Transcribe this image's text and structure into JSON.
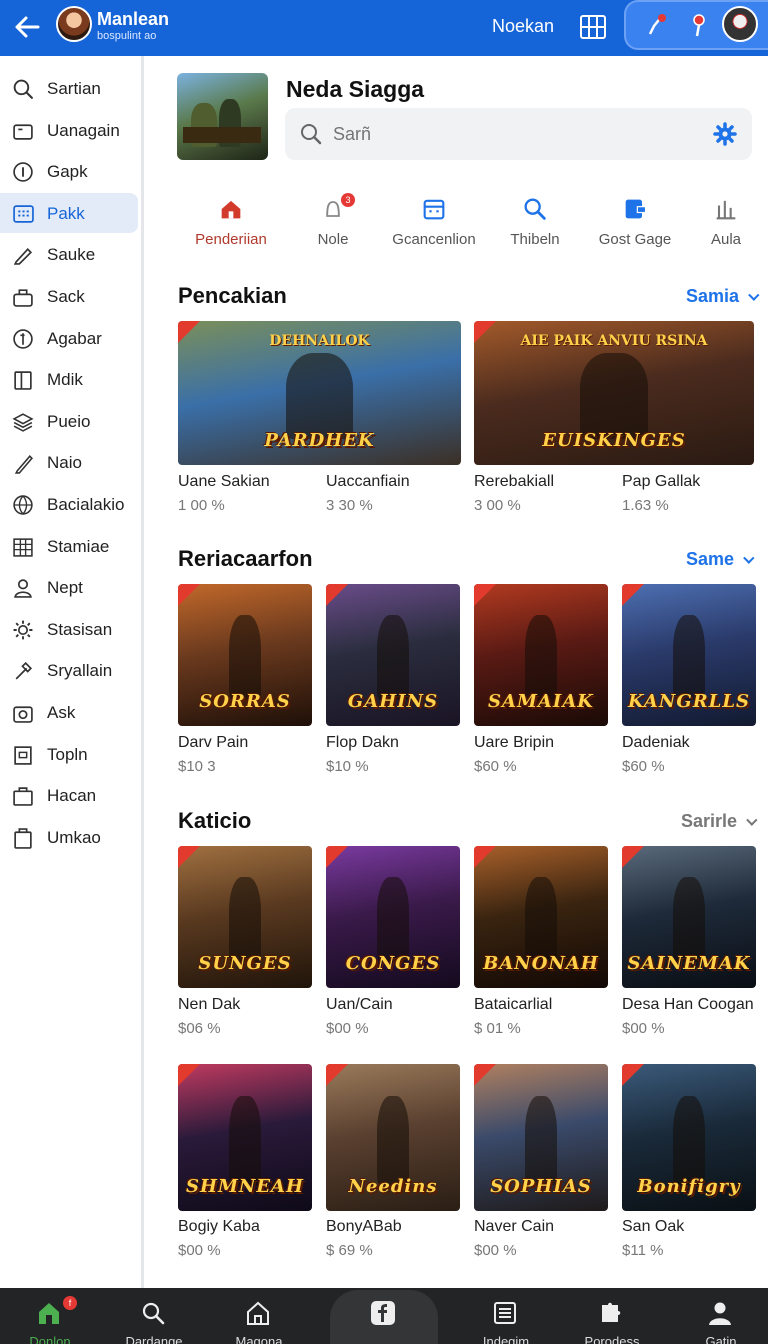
{
  "topbar": {
    "title": "Manlean",
    "subtitle": "bospulint ao",
    "link": "Noekan",
    "colors": {
      "bar": "#1565d8",
      "pill": "#3b82f1"
    }
  },
  "sidebar": {
    "active_index": 3,
    "items": [
      {
        "label": "Sartian",
        "icon": "search-icon"
      },
      {
        "label": "Uanagain",
        "icon": "folder-icon"
      },
      {
        "label": "Gapk",
        "icon": "info-icon"
      },
      {
        "label": "Pakk",
        "icon": "grid-icon"
      },
      {
        "label": "Sauke",
        "icon": "pencil-icon"
      },
      {
        "label": "Sack",
        "icon": "bag-icon"
      },
      {
        "label": "Agabar",
        "icon": "coin-icon"
      },
      {
        "label": "Mdik",
        "icon": "book-icon"
      },
      {
        "label": "Pueio",
        "icon": "layers-icon"
      },
      {
        "label": "Naio",
        "icon": "edit-icon"
      },
      {
        "label": "Bacialakio",
        "icon": "globe-icon"
      },
      {
        "label": "Stamiae",
        "icon": "table-icon"
      },
      {
        "label": "Nept",
        "icon": "user-icon"
      },
      {
        "label": "Stasisan",
        "icon": "gear-icon"
      },
      {
        "label": "Sryallain",
        "icon": "tool-icon"
      },
      {
        "label": "Ask",
        "icon": "camera-icon"
      },
      {
        "label": "Topln",
        "icon": "square-icon"
      },
      {
        "label": "Hacan",
        "icon": "briefcase-icon"
      },
      {
        "label": "Umkao",
        "icon": "clipboard-icon"
      }
    ]
  },
  "header": {
    "title": "Neda Siagga",
    "search_placeholder": "Sarñ"
  },
  "categories": [
    {
      "label": "Penderiian",
      "icon": "home-icon",
      "active": true
    },
    {
      "label": "Nole",
      "icon": "bell-icon",
      "badge": "3"
    },
    {
      "label": "Gcancenlion",
      "icon": "calendar-icon"
    },
    {
      "label": "Thibeln",
      "icon": "search-icon"
    },
    {
      "label": "Gost Gage",
      "icon": "flag-icon"
    },
    {
      "label": "Aula",
      "icon": "chart-icon"
    }
  ],
  "sections": [
    {
      "title": "Pencakian",
      "more": "Samia",
      "cards": [
        {
          "name": "Uane Sakian",
          "price": "1 00 %",
          "art": "PARDHEK",
          "art_top": "DEHNAILOK"
        },
        {
          "name": "Uaccanfiain",
          "price": "3 30 %"
        },
        {
          "name": "Rerebakiall",
          "price": "3 00 %",
          "art": "EUISKINGES",
          "art_top": "AIE PAIK ANVIU RSINA"
        },
        {
          "name": "Pap Gallak",
          "price": "1.63 %"
        }
      ]
    },
    {
      "title": "Reriacaarfon",
      "more": "Same",
      "cards": [
        {
          "name": "Darv Pain",
          "price": "$10 3",
          "art": "SORRAS"
        },
        {
          "name": "Flop Dakn",
          "price": "$10 %",
          "art": "GAHINS"
        },
        {
          "name": "Uare Bripin",
          "price": "$60 %",
          "art": "SAMAIAK"
        },
        {
          "name": "Dadeniak",
          "price": "$60 %",
          "art": "KANGRLLS"
        }
      ]
    },
    {
      "title": "Katicio",
      "more": "Sarirle",
      "cards": [
        {
          "name": "Nen Dak",
          "price": "$06 %",
          "art": "SUNGES"
        },
        {
          "name": "Uan/Cain",
          "price": "$00 %",
          "art": "CONGES"
        },
        {
          "name": "Bataicarlial",
          "price": "$ 01 %",
          "art": "BANONAH"
        },
        {
          "name": "Desa Han Coogan",
          "price": "$00 %",
          "art": "SAINEMAK"
        }
      ]
    },
    {
      "title": "",
      "more": "",
      "cards": [
        {
          "name": "Bogiy Kaba",
          "price": "$00 %",
          "art": "SHMNEAH"
        },
        {
          "name": "BonyABab",
          "price": "$ 69 %",
          "art": "Needins"
        },
        {
          "name": "Naver Cain",
          "price": "$00 %",
          "art": "SOPHIAS"
        },
        {
          "name": "San Oak",
          "price": "$11 %",
          "art": "Bonifigry"
        }
      ]
    }
  ],
  "bottom_nav": [
    {
      "label": "Donlon",
      "icon": "home-icon",
      "active": true,
      "badge": "f"
    },
    {
      "label": "Dardange",
      "icon": "search-icon"
    },
    {
      "label": "Magona",
      "icon": "house-icon"
    },
    {
      "label": "",
      "icon": "facebook-icon",
      "center": true
    },
    {
      "label": "Indegim",
      "icon": "list-icon"
    },
    {
      "label": "Porodess",
      "icon": "puzzle-icon"
    },
    {
      "label": "Gatin",
      "icon": "profile-icon"
    }
  ]
}
